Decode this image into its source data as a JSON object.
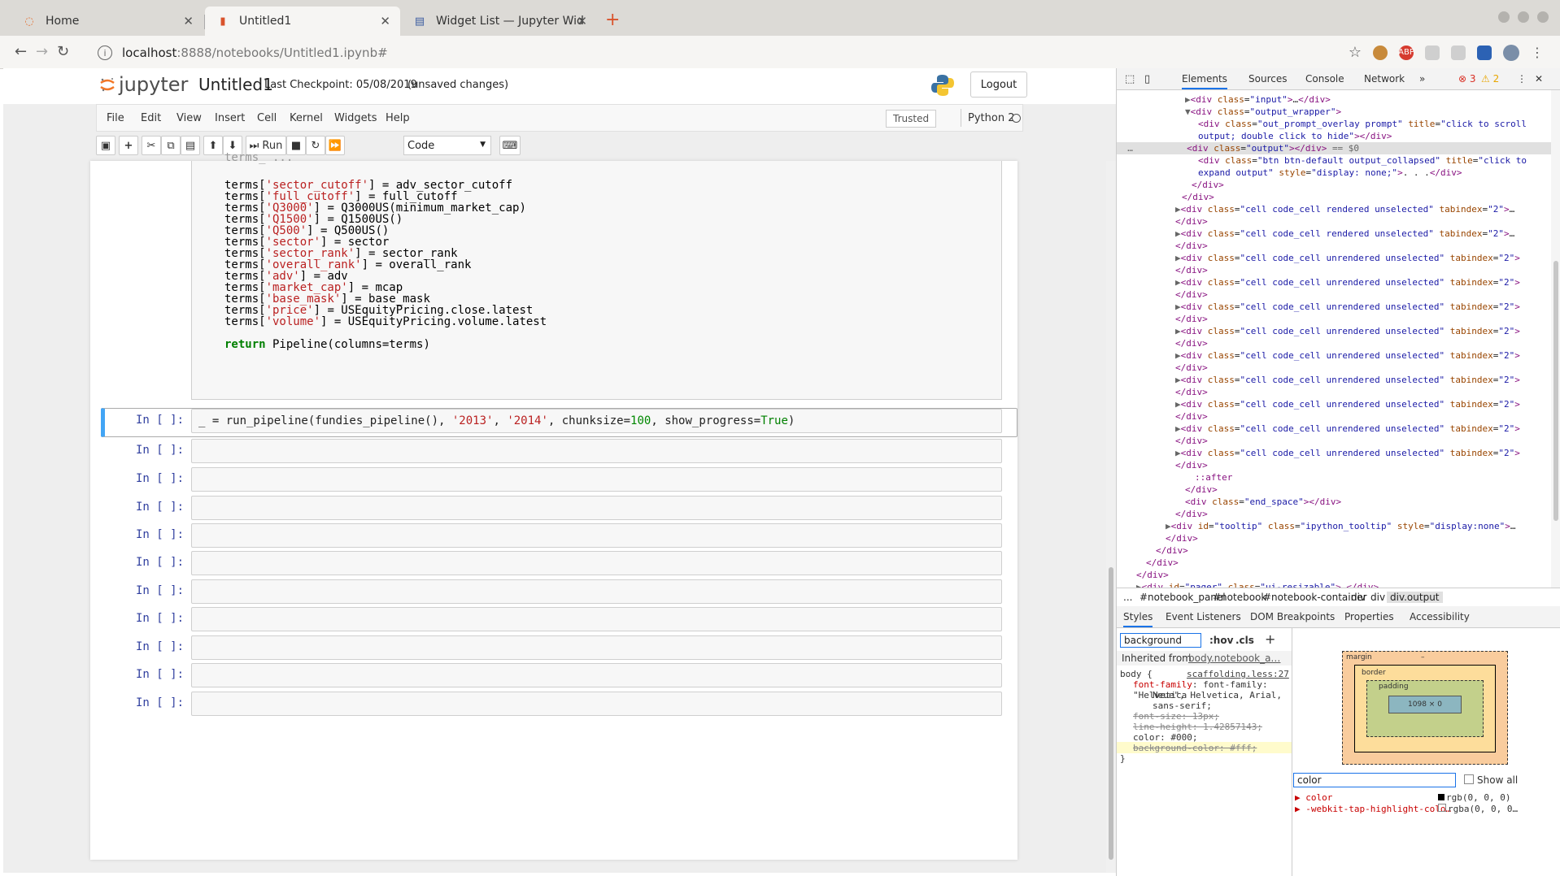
{
  "browser": {
    "tabs": [
      {
        "title": "Home",
        "active": false
      },
      {
        "title": "Untitled1",
        "active": true
      },
      {
        "title": "Widget List — Jupyter Wid",
        "active": false
      }
    ],
    "url_host": "localhost",
    "url_path": ":8888/notebooks/Untitled1.ipynb#"
  },
  "jupyter": {
    "logo_text": "jupyter",
    "notebook_name": "Untitled1",
    "checkpoint": "Last Checkpoint: 05/08/2019",
    "unsaved": "(unsaved changes)",
    "logout_label": "Logout",
    "menu": [
      "File",
      "Edit",
      "View",
      "Insert",
      "Cell",
      "Kernel",
      "Widgets",
      "Help"
    ],
    "trusted_label": "Trusted",
    "kernel_name": "Python 2",
    "run_label": "Run",
    "cell_type": "Code"
  },
  "code": {
    "lines": [
      "terms['sector_cutoff'] = adv_sector_cutoff",
      "terms['full_cutoff'] = full_cutoff",
      "terms['Q3000'] = Q3000US(minimum_market_cap)",
      "terms['Q1500'] = Q1500US()",
      "terms['Q500'] = Q500US()",
      "terms['sector'] = sector",
      "terms['sector_rank'] = sector_rank",
      "terms['overall_rank'] = overall_rank",
      "terms['adv'] = adv",
      "terms['market_cap'] = mcap",
      "terms['base_mask'] = base_mask",
      "terms['price'] = USEquityPricing.close.latest",
      "terms['volume'] = USEquityPricing.volume.latest",
      "",
      "return Pipeline(columns=terms)"
    ],
    "selected_cell": "_ = run_pipeline(fundies_pipeline(), '2013', '2014', chunksize=100, show_progress=True)",
    "prompt": "In [ ]:",
    "empty_cell_count": 10
  },
  "devtools": {
    "tabs": [
      "Elements",
      "Sources",
      "Console",
      "Network"
    ],
    "errors": "3",
    "warnings": "2",
    "breadcrumbs": [
      "...",
      "#notebook_panel",
      "#notebook",
      "#notebook-container",
      "div",
      "div",
      "div.output"
    ],
    "subtabs": [
      "Styles",
      "Event Listeners",
      "DOM Breakpoints",
      "Properties",
      "Accessibility"
    ],
    "filter_value": "background",
    "hov": ":hov",
    "cls": ".cls",
    "inherited_from_label": "Inherited from",
    "inherited_from_value": "body.notebook_a…",
    "rule_selector": "body {",
    "rule_source": "scaffolding.less:27",
    "rule_decls": [
      "font-family: \"Helvetica",
      "Neue\", Helvetica, Arial,",
      "sans-serif;",
      "font-size: 13px;",
      "line-height: 1.42857143;",
      "color: #000;",
      "background-color: #fff;"
    ],
    "rule_close": "}",
    "box_margin": "margin",
    "box_border": "border",
    "box_padding": "padding",
    "box_content": "1098 × 0",
    "box_dash": "–",
    "computed_filter": "color",
    "show_all": "Show all",
    "computed": [
      {
        "prop": "color",
        "value": "rgb(0, 0, 0)"
      },
      {
        "prop": "-webkit-tap-highlight-colo…",
        "value": "rgba(0, 0, 0…"
      }
    ]
  },
  "colors": {
    "accent_blue": "#42a5f5",
    "prompt_blue": "#303f9f",
    "string_red": "#ba2121",
    "keyword_green": "#008000"
  }
}
